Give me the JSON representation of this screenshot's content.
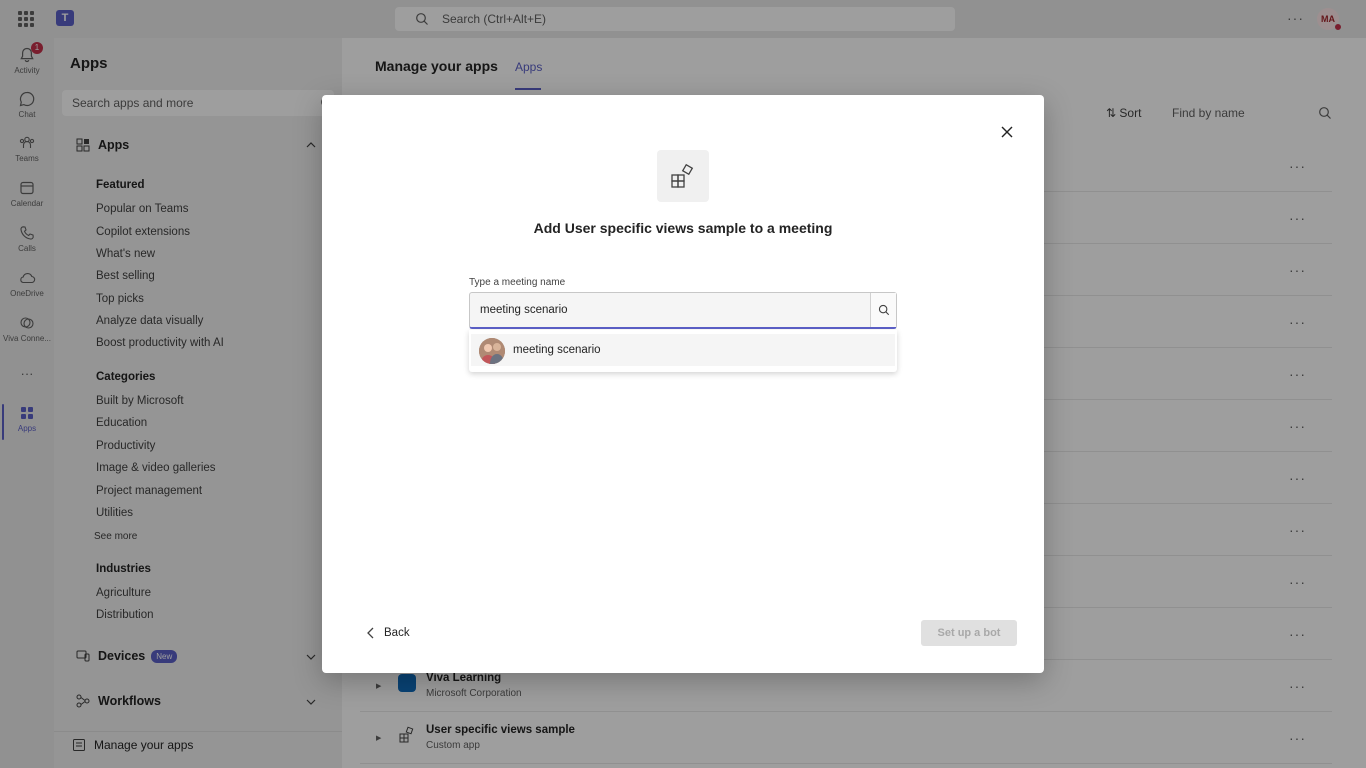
{
  "topbar": {
    "search_placeholder": "Search (Ctrl+Alt+E)",
    "more_label": "···",
    "avatar_initials": "MA"
  },
  "rail": {
    "items": [
      {
        "label": "Activity",
        "icon": "bell-icon",
        "badge": "1"
      },
      {
        "label": "Chat",
        "icon": "chat-icon"
      },
      {
        "label": "Teams",
        "icon": "teams-icon"
      },
      {
        "label": "Calendar",
        "icon": "calendar-icon"
      },
      {
        "label": "Calls",
        "icon": "phone-icon"
      },
      {
        "label": "OneDrive",
        "icon": "cloud-icon"
      },
      {
        "label": "Viva Conne...",
        "icon": "viva-icon"
      },
      {
        "label": "···",
        "icon": "more-icon"
      },
      {
        "label": "Apps",
        "icon": "apps-icon",
        "active": true
      }
    ]
  },
  "panel": {
    "title": "Apps",
    "search_placeholder": "Search apps and more",
    "apps_section": "Apps",
    "featured_heading": "Featured",
    "featured": [
      "Popular on Teams",
      "Copilot extensions",
      "What's new",
      "Best selling",
      "Top picks",
      "Analyze data visually",
      "Boost productivity with AI"
    ],
    "categories_heading": "Categories",
    "categories": [
      "Built by Microsoft",
      "Education",
      "Productivity",
      "Image & video galleries",
      "Project management",
      "Utilities"
    ],
    "see_more": "See more",
    "industries_heading": "Industries",
    "industries": [
      "Agriculture",
      "Distribution"
    ],
    "devices_label": "Devices",
    "devices_badge": "New",
    "workflows_label": "Workflows",
    "manage_label": "Manage your apps"
  },
  "main": {
    "title": "Manage your apps",
    "tab": "Apps",
    "sort_label": "Sort",
    "find_placeholder": "Find by name",
    "visible_rows": [
      {
        "name": "Viva Learning",
        "sub": "Microsoft Corporation",
        "icon_color": "#0f6cbd"
      },
      {
        "name": "User specific views sample",
        "sub": "Custom app",
        "icon_color": "#ffffff"
      }
    ]
  },
  "modal": {
    "title": "Add User specific views sample to a meeting",
    "field_label": "Type a meeting name",
    "field_value": "meeting scenario",
    "suggestion": "meeting scenario",
    "back_label": "Back",
    "primary_label": "Set up a bot"
  },
  "colors": {
    "accent": "#5b5fc7",
    "overlay": "rgba(0,0,0,0.38)"
  }
}
